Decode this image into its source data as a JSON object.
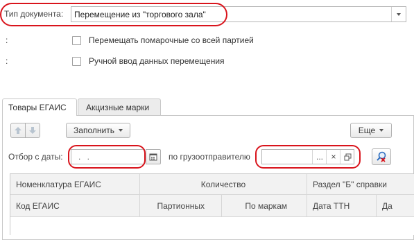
{
  "header": {
    "doc_type_label": "Тип документа:",
    "doc_type_value": "Перемещение из \"торгового зала\""
  },
  "options": {
    "colon1": ":",
    "colon2": ":",
    "move_remains_label": "Перемещать помарочные со всей партией",
    "manual_entry_label": "Ручной ввод данных перемещения"
  },
  "tabs": [
    {
      "label": "Товары ЕГАИС",
      "active": true
    },
    {
      "label": "Акцизные марки",
      "active": false
    }
  ],
  "toolbar": {
    "fill_label": "Заполнить",
    "more_label": "Еще"
  },
  "filter": {
    "date_label": "Отбор с даты:",
    "date_value": " .  .",
    "shipper_label": "по грузоотправителю",
    "shipper_value": "",
    "ellipsis": "...",
    "clear": "×"
  },
  "table": {
    "header_row1": [
      "Номенклатура ЕГАИС",
      "Количество",
      "Раздел \"Б\" справки"
    ],
    "header_row2": [
      "Код ЕГАИС",
      "Партионных",
      "По маркам",
      "Дата ТТН",
      "Да"
    ]
  },
  "colors": {
    "highlight": "#d9141c",
    "active_tab_bg": "#ffffff",
    "tab_bg": "#ececec"
  }
}
